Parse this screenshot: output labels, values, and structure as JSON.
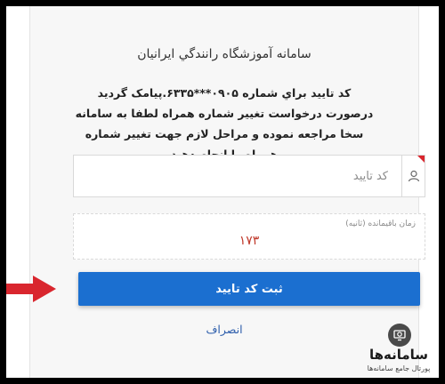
{
  "dialog": {
    "title": "سامانه آموزشگاه رانندگي ايرانيان",
    "message": "کد تاييد براي شماره ۰۹۰۵***۶۳۳۵.پيامک گرديد درصورت درخواست تغيير شماره همراه لطفا به سامانه سخا مراجعه نموده و مراحل لازم جهت تغيير شماره همراه را انجام دهيد",
    "code_input": {
      "placeholder": "کد تاييد",
      "value": ""
    },
    "timer": {
      "label": "زمان باقيمانده (ثانيه)",
      "value": "۱۷۳"
    },
    "submit_label": "ثبت کد تاييد",
    "cancel_label": "انصراف"
  },
  "logo": {
    "name": "سامانه‌ها",
    "tagline": "پورتال جامع سامانه‌ها"
  },
  "colors": {
    "primary": "#1b6fd0",
    "timer": "#c0392b",
    "arrow": "#d9262e",
    "link": "#2b5cab"
  },
  "icons": {
    "input_icon": "user-icon",
    "pointer": "arrow-right-icon",
    "logo_icon": "monitor-search-icon"
  }
}
